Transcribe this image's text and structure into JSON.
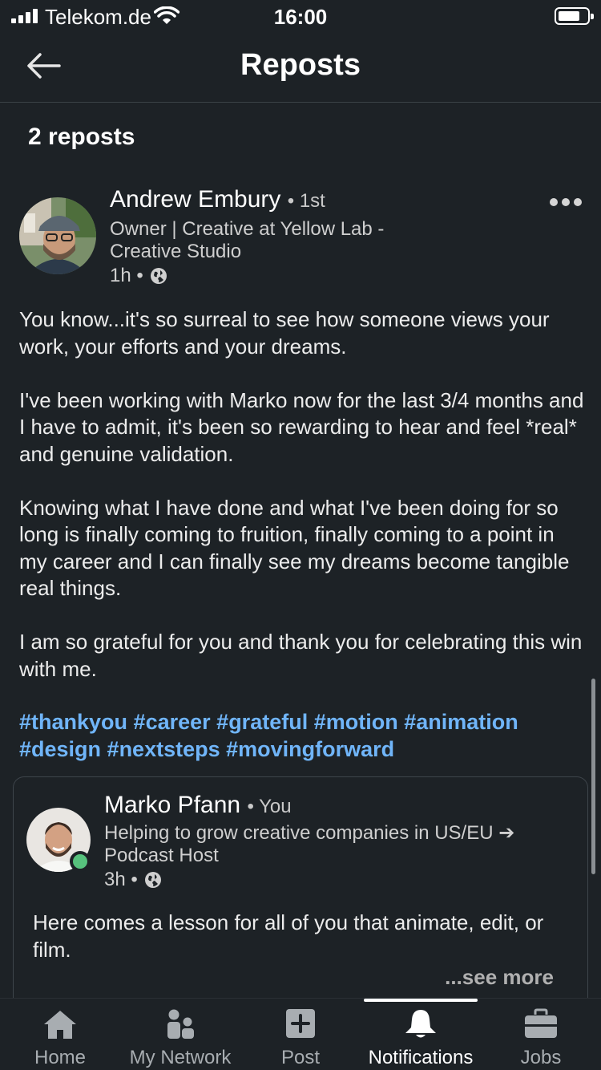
{
  "status_bar": {
    "carrier": "Telekom.de",
    "time": "16:00"
  },
  "header": {
    "title": "Reposts",
    "back_icon": "arrow-left-icon"
  },
  "reposts_count": "2 reposts",
  "post": {
    "author": "Andrew Embury",
    "degree": "• 1st",
    "headline": "Owner | Creative at Yellow Lab - Creative Studio",
    "time": "1h •",
    "paragraphs": [
      "You know...it's so surreal to see how someone views your work, your efforts and your dreams.",
      "I've been working with Marko now for the last 3/4 months and I have to admit, it's been so rewarding to hear and feel *real* and genuine validation.",
      "Knowing what I have done and what I've been doing for so long is finally coming to fruition, finally coming to a point in my career and I can finally see my dreams become tangible real things.",
      "I am so grateful for you and thank you for celebrating this win with me."
    ],
    "hashtags": [
      "#thankyou",
      "#career",
      "#grateful",
      "#motion",
      "#animation",
      "#design",
      "#nextsteps",
      "#movingforward"
    ]
  },
  "embedded_post": {
    "author": "Marko Pfann",
    "degree": "• You",
    "headline": "Helping to grow creative companies in US/EU ➔ Podcast Host",
    "time": "3h •",
    "body": "Here comes a lesson for all of you that animate, edit, or film.",
    "see_more": "...see more"
  },
  "tabs": [
    {
      "label": "Home",
      "icon": "home-icon"
    },
    {
      "label": "My Network",
      "icon": "network-icon"
    },
    {
      "label": "Post",
      "icon": "plus-box-icon"
    },
    {
      "label": "Notifications",
      "icon": "bell-icon",
      "active": true
    },
    {
      "label": "Jobs",
      "icon": "briefcase-icon"
    }
  ],
  "colors": {
    "background": "#1d2226",
    "hashtag": "#70b5f9",
    "online": "#57c27d"
  }
}
